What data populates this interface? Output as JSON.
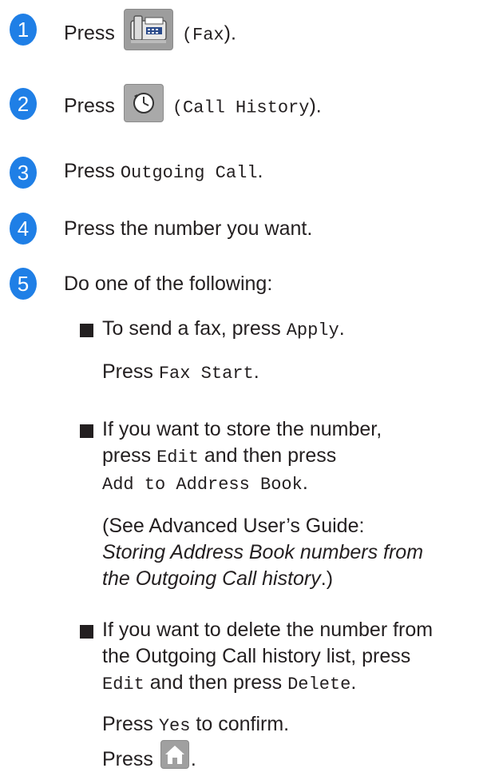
{
  "steps": [
    {
      "num": "1",
      "press": "Press",
      "code": "(Fax)",
      "tail": "."
    },
    {
      "num": "2",
      "press": "Press",
      "code": "(Call History)",
      "tail": ")."
    },
    {
      "num": "3",
      "press": "Press",
      "code": "Outgoing Call",
      "tail": "."
    },
    {
      "num": "4",
      "text": "Press the number you want."
    },
    {
      "num": "5",
      "text": "Do one of the following:"
    }
  ],
  "step1": {
    "code_pre": "(",
    "code": "Fax",
    "tail": ")."
  },
  "step2": {
    "code_pre": "(",
    "code": "Call History",
    "tail": ")."
  },
  "bullets": {
    "b1": {
      "text": "To send a fax, press ",
      "code": "Apply",
      "tail": ".",
      "sub_press": "Press ",
      "sub_code": "Fax Start",
      "sub_tail": "."
    },
    "b2": {
      "line1": "If you want to store the number,",
      "l2_pre": "press ",
      "l2_code": "Edit",
      "l2_mid": " and then press",
      "l3_code": "Add to Address Book",
      "l3_tail": ".",
      "see_pre": "(See Advanced User’s Guide:",
      "see_italic1": "Storing Address Book numbers from",
      "see_italic2": "the Outgoing Call history",
      "see_tail": ".)"
    },
    "b3": {
      "line1": "If you want to delete the number from",
      "line2": "the Outgoing Call history list, press",
      "l3_code": "Edit",
      "l3_mid": " and then press ",
      "l3_code2": "Delete",
      "l3_tail": ".",
      "yes_pre": "Press ",
      "yes_code": "Yes",
      "yes_tail": " to confirm.",
      "home_pre": "Press ",
      "home_tail": "."
    }
  },
  "icons": [
    "fax-icon",
    "call-history-icon",
    "home-icon"
  ]
}
